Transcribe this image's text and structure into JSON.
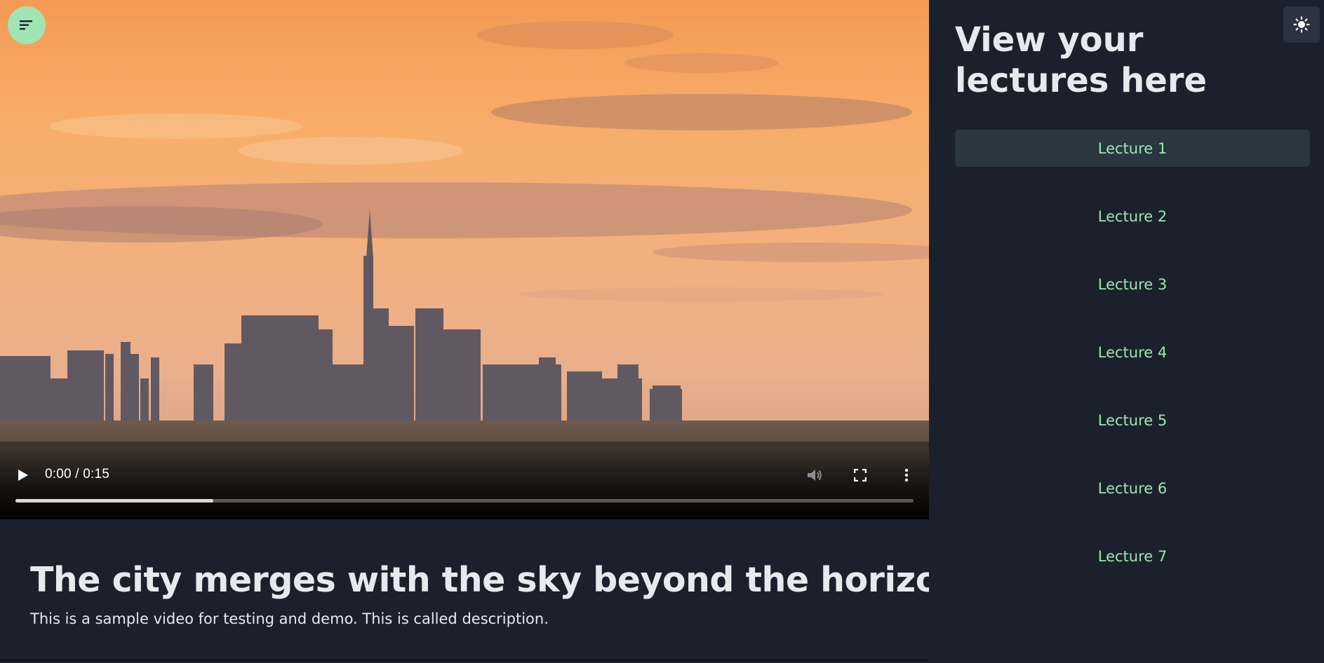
{
  "player": {
    "time_display": "0:00 / 0:15",
    "progress_fraction": 0.22
  },
  "video": {
    "title": "The city merges with the sky beyond the horizon",
    "description": "This is a sample video for testing and demo. This is called description."
  },
  "sidebar": {
    "heading": "View your lectures here",
    "lectures": [
      {
        "label": "Lecture 1",
        "active": true
      },
      {
        "label": "Lecture 2",
        "active": false
      },
      {
        "label": "Lecture 3",
        "active": false
      },
      {
        "label": "Lecture 4",
        "active": false
      },
      {
        "label": "Lecture 5",
        "active": false
      },
      {
        "label": "Lecture 6",
        "active": false
      },
      {
        "label": "Lecture 7",
        "active": false
      }
    ]
  },
  "icons": {
    "menu": "menu-lines-icon",
    "theme": "sun-icon",
    "play": "play-icon",
    "volume": "volume-icon",
    "fullscreen": "fullscreen-icon",
    "more": "more-vertical-icon"
  },
  "colors": {
    "accent": "#9ee5b2",
    "background": "#1b212c",
    "active_item": "#2a3640",
    "heading_text": "#e6e9ee"
  }
}
